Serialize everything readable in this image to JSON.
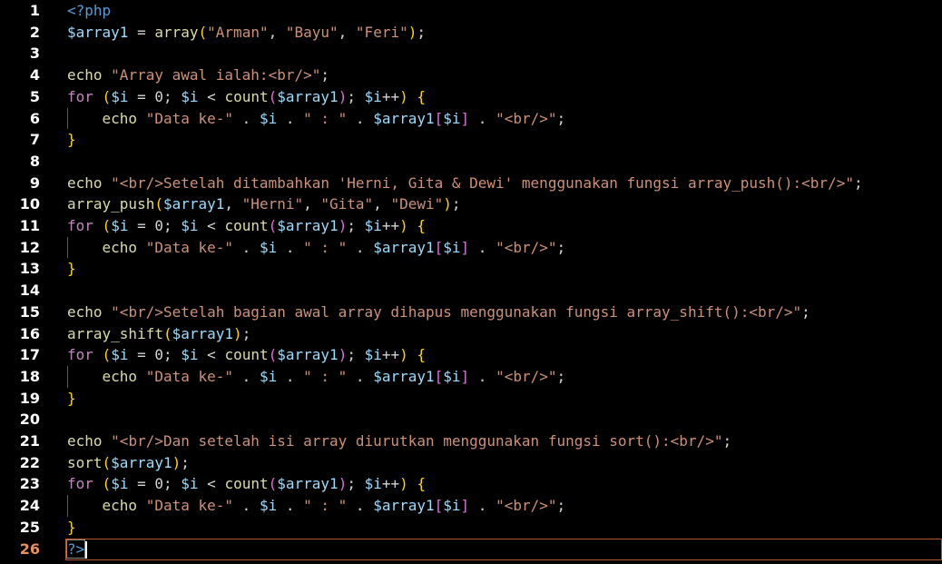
{
  "editor": {
    "current_line": "26",
    "lines": [
      {
        "num": "1",
        "tokens": [
          {
            "t": "<?php",
            "c": "tag"
          }
        ]
      },
      {
        "num": "2",
        "tokens": [
          {
            "t": "$array1",
            "c": "var"
          },
          {
            "t": " = ",
            "c": "plain"
          },
          {
            "t": "array",
            "c": "fn"
          },
          {
            "t": "(",
            "c": "paren"
          },
          {
            "t": "\"Arman\"",
            "c": "str"
          },
          {
            "t": ", ",
            "c": "plain"
          },
          {
            "t": "\"Bayu\"",
            "c": "str"
          },
          {
            "t": ", ",
            "c": "plain"
          },
          {
            "t": "\"Feri\"",
            "c": "str"
          },
          {
            "t": ")",
            "c": "paren"
          },
          {
            "t": ";",
            "c": "plain"
          }
        ]
      },
      {
        "num": "3",
        "tokens": []
      },
      {
        "num": "4",
        "tokens": [
          {
            "t": "echo",
            "c": "fn"
          },
          {
            "t": " ",
            "c": "plain"
          },
          {
            "t": "\"Array awal ialah:<br/>\"",
            "c": "str"
          },
          {
            "t": ";",
            "c": "plain"
          }
        ]
      },
      {
        "num": "5",
        "tokens": [
          {
            "t": "for",
            "c": "kw"
          },
          {
            "t": " ",
            "c": "plain"
          },
          {
            "t": "(",
            "c": "paren"
          },
          {
            "t": "$i",
            "c": "var"
          },
          {
            "t": " = ",
            "c": "plain"
          },
          {
            "t": "0",
            "c": "plain"
          },
          {
            "t": "; ",
            "c": "plain"
          },
          {
            "t": "$i",
            "c": "var"
          },
          {
            "t": " < ",
            "c": "plain"
          },
          {
            "t": "count",
            "c": "fn"
          },
          {
            "t": "(",
            "c": "brk"
          },
          {
            "t": "$array1",
            "c": "var"
          },
          {
            "t": ")",
            "c": "brk"
          },
          {
            "t": "; ",
            "c": "plain"
          },
          {
            "t": "$i",
            "c": "var"
          },
          {
            "t": "++",
            "c": "plain"
          },
          {
            "t": ")",
            "c": "paren"
          },
          {
            "t": " ",
            "c": "plain"
          },
          {
            "t": "{",
            "c": "paren"
          }
        ]
      },
      {
        "num": "6",
        "indent": true,
        "tokens": [
          {
            "t": "    echo",
            "c": "fn"
          },
          {
            "t": " ",
            "c": "plain"
          },
          {
            "t": "\"Data ke-\"",
            "c": "str"
          },
          {
            "t": " . ",
            "c": "plain"
          },
          {
            "t": "$i",
            "c": "var"
          },
          {
            "t": " . ",
            "c": "plain"
          },
          {
            "t": "\" : \"",
            "c": "str"
          },
          {
            "t": " . ",
            "c": "plain"
          },
          {
            "t": "$array1",
            "c": "var"
          },
          {
            "t": "[",
            "c": "brk"
          },
          {
            "t": "$i",
            "c": "var"
          },
          {
            "t": "]",
            "c": "brk"
          },
          {
            "t": " . ",
            "c": "plain"
          },
          {
            "t": "\"<br/>\"",
            "c": "str"
          },
          {
            "t": ";",
            "c": "plain"
          }
        ]
      },
      {
        "num": "7",
        "tokens": [
          {
            "t": "}",
            "c": "paren"
          }
        ]
      },
      {
        "num": "8",
        "tokens": []
      },
      {
        "num": "9",
        "tokens": [
          {
            "t": "echo",
            "c": "fn"
          },
          {
            "t": " ",
            "c": "plain"
          },
          {
            "t": "\"<br/>Setelah ditambahkan 'Herni, Gita & Dewi' menggunakan fungsi array_push():<br/>\"",
            "c": "str"
          },
          {
            "t": ";",
            "c": "plain"
          }
        ]
      },
      {
        "num": "10",
        "tokens": [
          {
            "t": "array_push",
            "c": "fn"
          },
          {
            "t": "(",
            "c": "paren"
          },
          {
            "t": "$array1",
            "c": "var"
          },
          {
            "t": ", ",
            "c": "plain"
          },
          {
            "t": "\"Herni\"",
            "c": "str"
          },
          {
            "t": ", ",
            "c": "plain"
          },
          {
            "t": "\"Gita\"",
            "c": "str"
          },
          {
            "t": ", ",
            "c": "plain"
          },
          {
            "t": "\"Dewi\"",
            "c": "str"
          },
          {
            "t": ")",
            "c": "paren"
          },
          {
            "t": ";",
            "c": "plain"
          }
        ]
      },
      {
        "num": "11",
        "tokens": [
          {
            "t": "for",
            "c": "kw"
          },
          {
            "t": " ",
            "c": "plain"
          },
          {
            "t": "(",
            "c": "paren"
          },
          {
            "t": "$i",
            "c": "var"
          },
          {
            "t": " = ",
            "c": "plain"
          },
          {
            "t": "0",
            "c": "plain"
          },
          {
            "t": "; ",
            "c": "plain"
          },
          {
            "t": "$i",
            "c": "var"
          },
          {
            "t": " < ",
            "c": "plain"
          },
          {
            "t": "count",
            "c": "fn"
          },
          {
            "t": "(",
            "c": "brk"
          },
          {
            "t": "$array1",
            "c": "var"
          },
          {
            "t": ")",
            "c": "brk"
          },
          {
            "t": "; ",
            "c": "plain"
          },
          {
            "t": "$i",
            "c": "var"
          },
          {
            "t": "++",
            "c": "plain"
          },
          {
            "t": ")",
            "c": "paren"
          },
          {
            "t": " ",
            "c": "plain"
          },
          {
            "t": "{",
            "c": "paren"
          }
        ]
      },
      {
        "num": "12",
        "indent": true,
        "tokens": [
          {
            "t": "    echo",
            "c": "fn"
          },
          {
            "t": " ",
            "c": "plain"
          },
          {
            "t": "\"Data ke-\"",
            "c": "str"
          },
          {
            "t": " . ",
            "c": "plain"
          },
          {
            "t": "$i",
            "c": "var"
          },
          {
            "t": " . ",
            "c": "plain"
          },
          {
            "t": "\" : \"",
            "c": "str"
          },
          {
            "t": " . ",
            "c": "plain"
          },
          {
            "t": "$array1",
            "c": "var"
          },
          {
            "t": "[",
            "c": "brk"
          },
          {
            "t": "$i",
            "c": "var"
          },
          {
            "t": "]",
            "c": "brk"
          },
          {
            "t": " . ",
            "c": "plain"
          },
          {
            "t": "\"<br/>\"",
            "c": "str"
          },
          {
            "t": ";",
            "c": "plain"
          }
        ]
      },
      {
        "num": "13",
        "tokens": [
          {
            "t": "}",
            "c": "paren"
          }
        ]
      },
      {
        "num": "14",
        "tokens": []
      },
      {
        "num": "15",
        "tokens": [
          {
            "t": "echo",
            "c": "fn"
          },
          {
            "t": " ",
            "c": "plain"
          },
          {
            "t": "\"<br/>Setelah bagian awal array dihapus menggunakan fungsi array_shift():<br/>\"",
            "c": "str"
          },
          {
            "t": ";",
            "c": "plain"
          }
        ]
      },
      {
        "num": "16",
        "tokens": [
          {
            "t": "array_shift",
            "c": "fn"
          },
          {
            "t": "(",
            "c": "paren"
          },
          {
            "t": "$array1",
            "c": "var"
          },
          {
            "t": ")",
            "c": "paren"
          },
          {
            "t": ";",
            "c": "plain"
          }
        ]
      },
      {
        "num": "17",
        "tokens": [
          {
            "t": "for",
            "c": "kw"
          },
          {
            "t": " ",
            "c": "plain"
          },
          {
            "t": "(",
            "c": "paren"
          },
          {
            "t": "$i",
            "c": "var"
          },
          {
            "t": " = ",
            "c": "plain"
          },
          {
            "t": "0",
            "c": "plain"
          },
          {
            "t": "; ",
            "c": "plain"
          },
          {
            "t": "$i",
            "c": "var"
          },
          {
            "t": " < ",
            "c": "plain"
          },
          {
            "t": "count",
            "c": "fn"
          },
          {
            "t": "(",
            "c": "brk"
          },
          {
            "t": "$array1",
            "c": "var"
          },
          {
            "t": ")",
            "c": "brk"
          },
          {
            "t": "; ",
            "c": "plain"
          },
          {
            "t": "$i",
            "c": "var"
          },
          {
            "t": "++",
            "c": "plain"
          },
          {
            "t": ")",
            "c": "paren"
          },
          {
            "t": " ",
            "c": "plain"
          },
          {
            "t": "{",
            "c": "paren"
          }
        ]
      },
      {
        "num": "18",
        "indent": true,
        "tokens": [
          {
            "t": "    echo",
            "c": "fn"
          },
          {
            "t": " ",
            "c": "plain"
          },
          {
            "t": "\"Data ke-\"",
            "c": "str"
          },
          {
            "t": " . ",
            "c": "plain"
          },
          {
            "t": "$i",
            "c": "var"
          },
          {
            "t": " . ",
            "c": "plain"
          },
          {
            "t": "\" : \"",
            "c": "str"
          },
          {
            "t": " . ",
            "c": "plain"
          },
          {
            "t": "$array1",
            "c": "var"
          },
          {
            "t": "[",
            "c": "brk"
          },
          {
            "t": "$i",
            "c": "var"
          },
          {
            "t": "]",
            "c": "brk"
          },
          {
            "t": " . ",
            "c": "plain"
          },
          {
            "t": "\"<br/>\"",
            "c": "str"
          },
          {
            "t": ";",
            "c": "plain"
          }
        ]
      },
      {
        "num": "19",
        "tokens": [
          {
            "t": "}",
            "c": "paren"
          }
        ]
      },
      {
        "num": "20",
        "tokens": []
      },
      {
        "num": "21",
        "tokens": [
          {
            "t": "echo",
            "c": "fn"
          },
          {
            "t": " ",
            "c": "plain"
          },
          {
            "t": "\"<br/>Dan setelah isi array diurutkan menggunakan fungsi sort():<br/>\"",
            "c": "str"
          },
          {
            "t": ";",
            "c": "plain"
          }
        ]
      },
      {
        "num": "22",
        "tokens": [
          {
            "t": "sort",
            "c": "fn"
          },
          {
            "t": "(",
            "c": "paren"
          },
          {
            "t": "$array1",
            "c": "var"
          },
          {
            "t": ")",
            "c": "paren"
          },
          {
            "t": ";",
            "c": "plain"
          }
        ]
      },
      {
        "num": "23",
        "tokens": [
          {
            "t": "for",
            "c": "kw"
          },
          {
            "t": " ",
            "c": "plain"
          },
          {
            "t": "(",
            "c": "paren"
          },
          {
            "t": "$i",
            "c": "var"
          },
          {
            "t": " = ",
            "c": "plain"
          },
          {
            "t": "0",
            "c": "plain"
          },
          {
            "t": "; ",
            "c": "plain"
          },
          {
            "t": "$i",
            "c": "var"
          },
          {
            "t": " < ",
            "c": "plain"
          },
          {
            "t": "count",
            "c": "fn"
          },
          {
            "t": "(",
            "c": "brk"
          },
          {
            "t": "$array1",
            "c": "var"
          },
          {
            "t": ")",
            "c": "brk"
          },
          {
            "t": "; ",
            "c": "plain"
          },
          {
            "t": "$i",
            "c": "var"
          },
          {
            "t": "++",
            "c": "plain"
          },
          {
            "t": ")",
            "c": "paren"
          },
          {
            "t": " ",
            "c": "plain"
          },
          {
            "t": "{",
            "c": "paren"
          }
        ]
      },
      {
        "num": "24",
        "indent": true,
        "tokens": [
          {
            "t": "    echo",
            "c": "fn"
          },
          {
            "t": " ",
            "c": "plain"
          },
          {
            "t": "\"Data ke-\"",
            "c": "str"
          },
          {
            "t": " . ",
            "c": "plain"
          },
          {
            "t": "$i",
            "c": "var"
          },
          {
            "t": " . ",
            "c": "plain"
          },
          {
            "t": "\" : \"",
            "c": "str"
          },
          {
            "t": " . ",
            "c": "plain"
          },
          {
            "t": "$array1",
            "c": "var"
          },
          {
            "t": "[",
            "c": "brk"
          },
          {
            "t": "$i",
            "c": "var"
          },
          {
            "t": "]",
            "c": "brk"
          },
          {
            "t": " . ",
            "c": "plain"
          },
          {
            "t": "\"<br/>\"",
            "c": "str"
          },
          {
            "t": ";",
            "c": "plain"
          }
        ]
      },
      {
        "num": "25",
        "tokens": [
          {
            "t": "}",
            "c": "paren"
          }
        ]
      },
      {
        "num": "26",
        "tokens": [
          {
            "t": "?>",
            "c": "tag"
          }
        ]
      }
    ]
  },
  "colors": {
    "background": "#000000",
    "keyword": "#c586c0",
    "variable": "#9cdcfe",
    "function": "#dcdcaa",
    "string": "#ce9178",
    "bracket": "#ffd700",
    "inner_bracket": "#da70d6",
    "php_tag": "#569cd6",
    "current_line_border": "#b5562a",
    "current_line_number": "#e8915a"
  }
}
